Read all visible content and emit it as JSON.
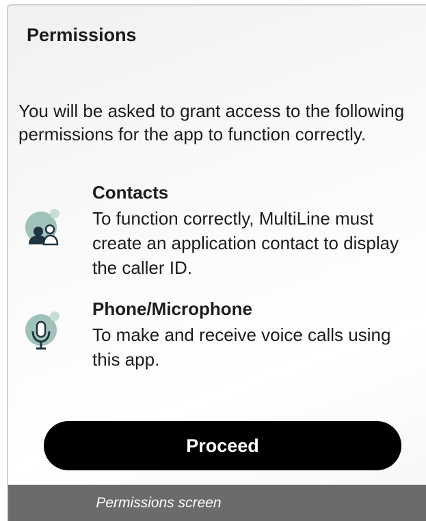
{
  "header": {
    "title": "Permissions"
  },
  "intro": {
    "text": "You will be asked to grant access to the following permissions for the app to function correctly."
  },
  "permissions": [
    {
      "icon": "contacts-icon",
      "title": "Contacts",
      "description": "To function correctly, MultiLine must create an application contact to display the caller ID."
    },
    {
      "icon": "microphone-icon",
      "title": "Phone/Microphone",
      "description": "To make and receive voice calls using this app."
    }
  ],
  "actions": {
    "proceed_label": "Proceed"
  },
  "caption": {
    "text": "Permissions screen"
  },
  "colors": {
    "icon_bubble": "#9fc2bb",
    "icon_dot": "#c9dcd8",
    "icon_glyph": "#1f3340",
    "button": "#000000",
    "caption_bar": "#6b6b6b"
  }
}
